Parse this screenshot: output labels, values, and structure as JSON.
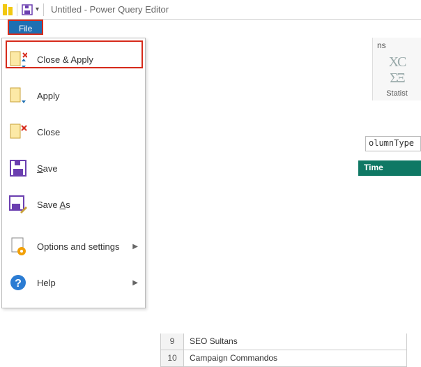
{
  "titlebar": {
    "title": "Untitled - Power Query Editor"
  },
  "file_tab": {
    "label": "File"
  },
  "menu": {
    "close_apply": "Close & Apply",
    "apply": "Apply",
    "close": "Close",
    "save": "Save",
    "save_as": "Save As",
    "options": "Options and settings",
    "help": "Help"
  },
  "ribbon_right": {
    "group_trunc": "ns",
    "stat_label": "Statist"
  },
  "formula_bar_trunc": "olumnType",
  "column_header_trunc": "Time",
  "table": {
    "rows": [
      {
        "n": "9",
        "value": "SEO Sultans"
      },
      {
        "n": "10",
        "value": "Campaign Commandos"
      }
    ]
  },
  "colors": {
    "file_tab_bg": "#1f6fb2",
    "highlight_border": "#d62a1a",
    "header_bg": "#0f7864"
  }
}
